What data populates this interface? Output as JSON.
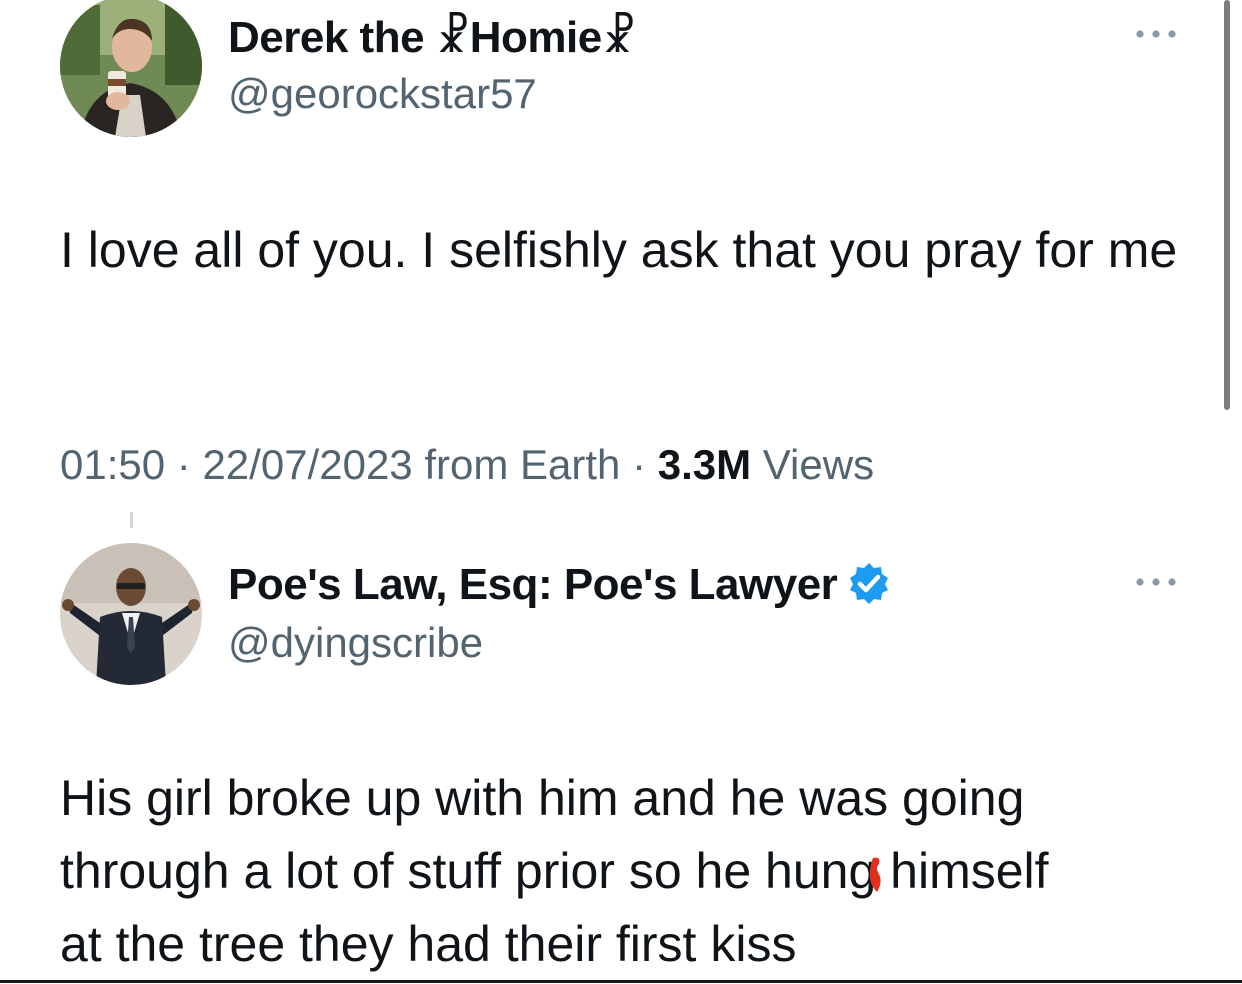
{
  "tweet": {
    "author": {
      "display_name": "Derek the ☧Homie☧",
      "handle": "@georockstar57",
      "avatar_icon": "profile-photo-man-holding-cup"
    },
    "text": "I love all of you. I selfishly ask that you pray for me",
    "time": "01:50",
    "separator": "·",
    "date": "22/07/2023",
    "source": "from Earth",
    "views_count": "3.3M",
    "views_label": "Views",
    "more_icon": "more-horizontal-icon"
  },
  "reply": {
    "author": {
      "display_name": "Poe's Law, Esq: Poe's Lawyer",
      "handle": "@dyingscribe",
      "verified": true,
      "verified_color": "#1d9bf0",
      "avatar_icon": "profile-illustration-man-in-suit"
    },
    "text_lines": [
      "His girl broke up with him and he was going",
      "through a lot of stuff prior so he hung himself",
      "at the tree they had their first kiss"
    ],
    "more_icon": "more-horizontal-icon"
  },
  "colors": {
    "text_primary": "#0f1419",
    "text_secondary": "#536471",
    "verified_blue": "#1d9bf0",
    "annotation_mark": "#e0301e"
  }
}
